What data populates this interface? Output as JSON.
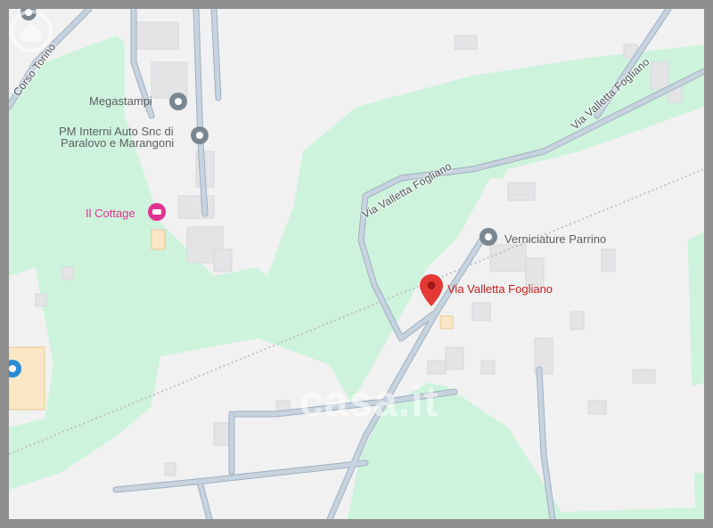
{
  "map": {
    "roads": {
      "corso_torino": "Corso Torino",
      "via_valletta_1": "Via Valletta Fogliano",
      "via_valletta_2": "Via Valletta Fogliano"
    },
    "pois": {
      "megastampi": "Megastampi",
      "pm_interni_line1": "PM Interni Auto Snc di",
      "pm_interni_line2": "Paralovo e Marangoni",
      "il_cottage": "Il Cottage",
      "verniciature": "Verniciature Parrino"
    },
    "pin_label": "Via Valletta Fogliano",
    "watermark": "casa.it",
    "colors": {
      "park": "#cdf3dd",
      "land": "#f1f1f1",
      "road": "#b9c6d2",
      "pin": "#e53935",
      "hotel": "#e0338f"
    }
  }
}
